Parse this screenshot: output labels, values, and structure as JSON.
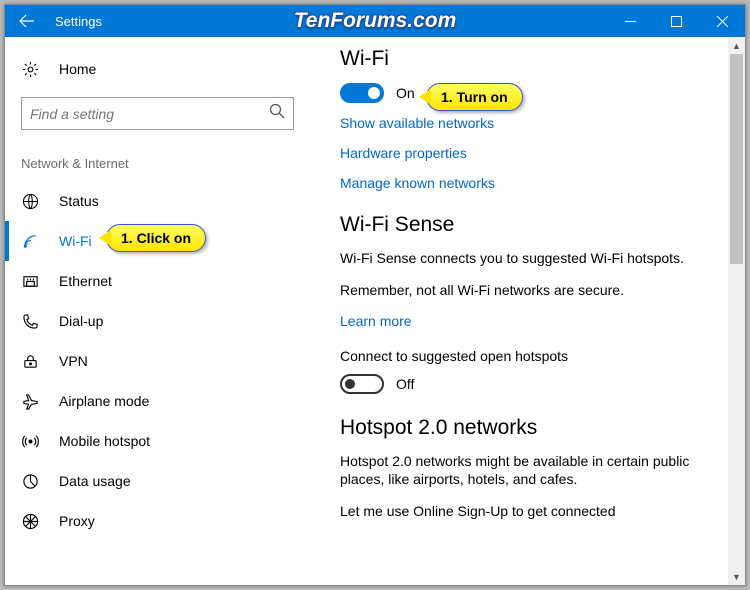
{
  "window": {
    "title": "Settings"
  },
  "watermark": "TenForums.com",
  "sidebar": {
    "home": "Home",
    "search_placeholder": "Find a setting",
    "category": "Network & Internet",
    "items": [
      {
        "label": "Status"
      },
      {
        "label": "Wi-Fi"
      },
      {
        "label": "Ethernet"
      },
      {
        "label": "Dial-up"
      },
      {
        "label": "VPN"
      },
      {
        "label": "Airplane mode"
      },
      {
        "label": "Mobile hotspot"
      },
      {
        "label": "Data usage"
      },
      {
        "label": "Proxy"
      }
    ]
  },
  "main": {
    "wifi_title": "Wi-Fi",
    "wifi_toggle": "On",
    "link_show": "Show available networks",
    "link_hw": "Hardware properties",
    "link_known": "Manage known networks",
    "sense_title": "Wi-Fi Sense",
    "sense_body1": "Wi-Fi Sense connects you to suggested Wi-Fi hotspots.",
    "sense_body2": "Remember, not all Wi-Fi networks are secure.",
    "learn_more": "Learn more",
    "connect_label": "Connect to suggested open hotspots",
    "connect_toggle": "Off",
    "hotspot_title": "Hotspot 2.0 networks",
    "hotspot_body": "Hotspot 2.0 networks might be available in certain public places, like airports, hotels, and cafes.",
    "hotspot_body2": "Let me use Online Sign-Up to get connected"
  },
  "callouts": {
    "click": "1. Click on",
    "turn": "1. Turn on"
  }
}
